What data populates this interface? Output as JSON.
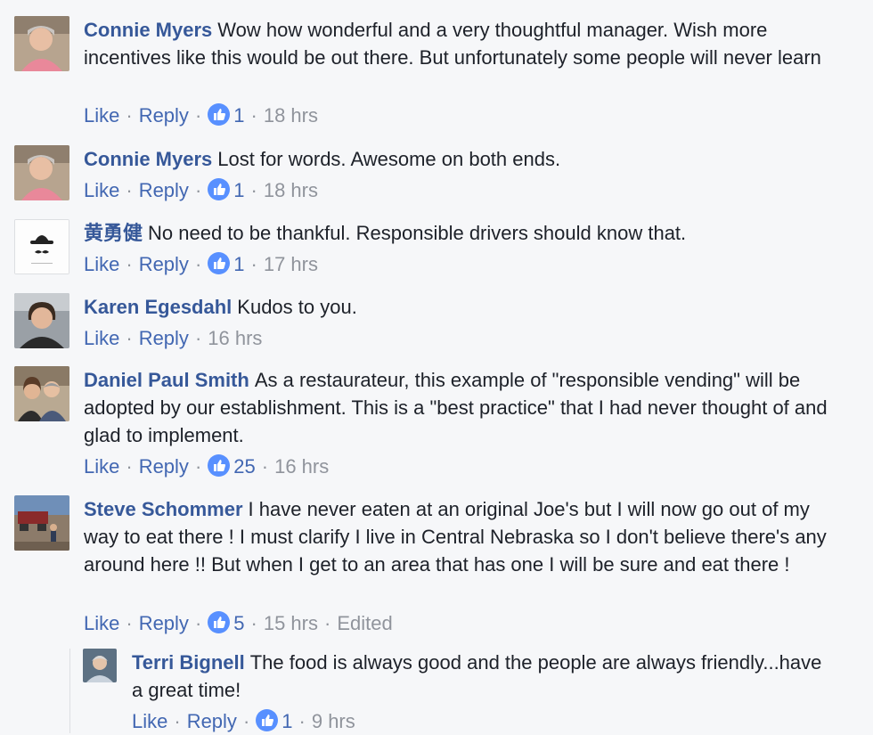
{
  "ui": {
    "like": "Like",
    "reply": "Reply",
    "sep": "·"
  },
  "comments": [
    {
      "name": "Connie Myers",
      "text": "Wow how wonderful and a very thoughtful manager. Wish more incentives like this would be out there. But unfortunately some people will never learn",
      "likes": "1",
      "time": "18 hrs",
      "avatar_icon": "person-photo"
    },
    {
      "name": "Connie Myers",
      "text": "Lost for words. Awesome on both ends.",
      "likes": "1",
      "time": "18 hrs",
      "avatar_icon": "person-photo"
    },
    {
      "name": "黄勇健",
      "text": "No need to be thankful. Responsible drivers should know that.",
      "likes": "1",
      "time": "17 hrs",
      "avatar_icon": "bowler-hat-mustache-icon"
    },
    {
      "name": "Karen Egesdahl",
      "text": "Kudos to you.",
      "time": "16 hrs",
      "avatar_icon": "person-photo"
    },
    {
      "name": "Daniel Paul Smith",
      "text": "As a restaurateur, this example of \"responsible vending\" will be adopted by our establishment. This is a \"best practice\" that I had never thought of and glad to implement.",
      "likes": "25",
      "time": "16 hrs",
      "avatar_icon": "couple-photo"
    },
    {
      "name": "Steve Schommer",
      "text": "I have never eaten at an original Joe's but I will now go out of my way to eat there ! I must clarify I live in Central Nebraska so I don't believe there's any around here !! But when I get to an area that has one I will be sure and eat there !",
      "likes": "5",
      "time": "15 hrs",
      "edited": "Edited",
      "avatar_icon": "outdoor-photo"
    }
  ],
  "reply": {
    "name": "Terri Bignell",
    "text": "The food is always good and the people are always friendly...have a great time!",
    "likes": "1",
    "time": "9 hrs",
    "avatar_icon": "person-photo"
  },
  "colors": {
    "name_blue": "#365899",
    "link_blue": "#4267b2",
    "meta_gray": "#90949c",
    "like_icon": "#5890ff",
    "background": "#f6f7f9"
  }
}
